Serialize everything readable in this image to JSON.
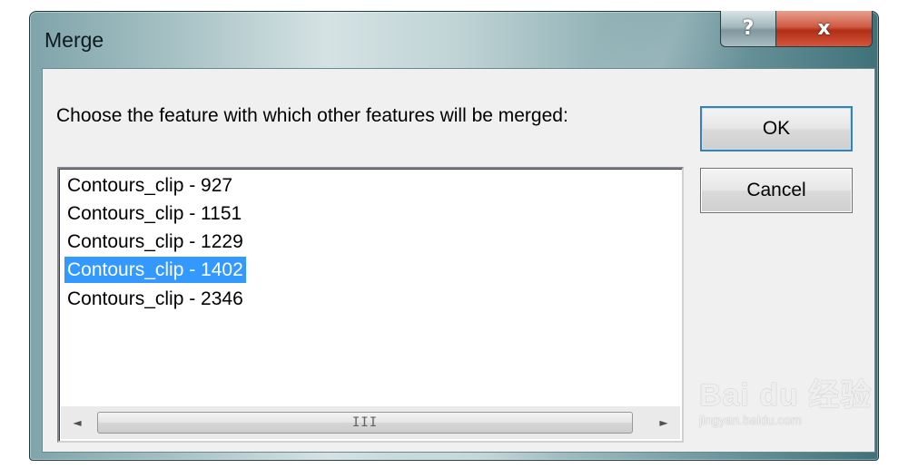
{
  "window": {
    "title": "Merge",
    "help_label": "?",
    "close_label": "x"
  },
  "dialog": {
    "prompt": "Choose the feature with which other features will be merged:",
    "ok_label": "OK",
    "cancel_label": "Cancel",
    "items": [
      {
        "label": "Contours_clip - 927",
        "selected": false
      },
      {
        "label": "Contours_clip - 1151",
        "selected": false
      },
      {
        "label": "Contours_clip - 1229",
        "selected": false
      },
      {
        "label": "Contours_clip - 1402",
        "selected": true
      },
      {
        "label": "Contours_clip - 2346",
        "selected": false
      }
    ],
    "scrollbar": {
      "left_arrow": "◄",
      "right_arrow": "►",
      "grip": "III"
    }
  },
  "watermark": {
    "logo": "Bai du 经验",
    "url": "jingyan.baidu.com"
  },
  "colors": {
    "selection": "#3399ff",
    "close_button": "#c8412a",
    "frame": "#7fa4aa"
  }
}
